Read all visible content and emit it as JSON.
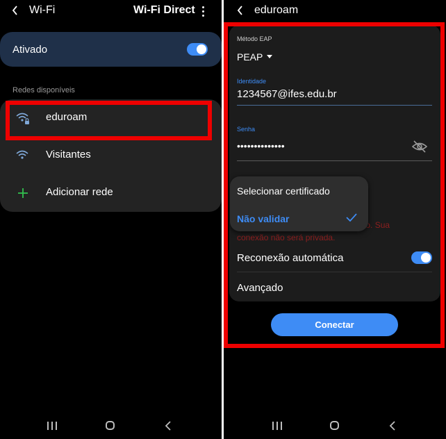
{
  "left": {
    "header": {
      "title": "Wi-Fi",
      "action": "Wi-Fi Direct"
    },
    "toggle_card": {
      "label": "Ativado",
      "enabled": true
    },
    "section_label": "Redes disponíveis",
    "networks": [
      {
        "name": "eduroam",
        "icon": "wifi-lock-icon",
        "highlighted": true
      },
      {
        "name": "Visitantes",
        "icon": "wifi-icon"
      },
      {
        "name": "Adicionar rede",
        "icon": "plus-icon"
      }
    ]
  },
  "right": {
    "header": {
      "title": "eduroam"
    },
    "eap": {
      "label": "Método EAP",
      "value": "PEAP"
    },
    "identity": {
      "label": "Identidade",
      "value": "1234567@ifes.edu.br"
    },
    "password": {
      "label": "Senha",
      "value": "••••••••••••••",
      "visibility_icon": "eye-off-icon"
    },
    "certificate_menu": {
      "options": [
        "Selecionar certificado",
        "Não validar"
      ],
      "selected": "Não validar"
    },
    "warning": {
      "line1_visible": "ado. Sua",
      "line2": "conexão não será privada."
    },
    "auto_reconnect": {
      "label": "Reconexão automática",
      "enabled": true
    },
    "advanced": {
      "label": "Avançado"
    },
    "connect_button": "Conectar"
  },
  "colors": {
    "accent": "#3e8cf5",
    "highlight_red": "#ee0000",
    "warning_text": "#8e1f1f",
    "card_bg": "#232323",
    "screen_bg": "#000000"
  }
}
